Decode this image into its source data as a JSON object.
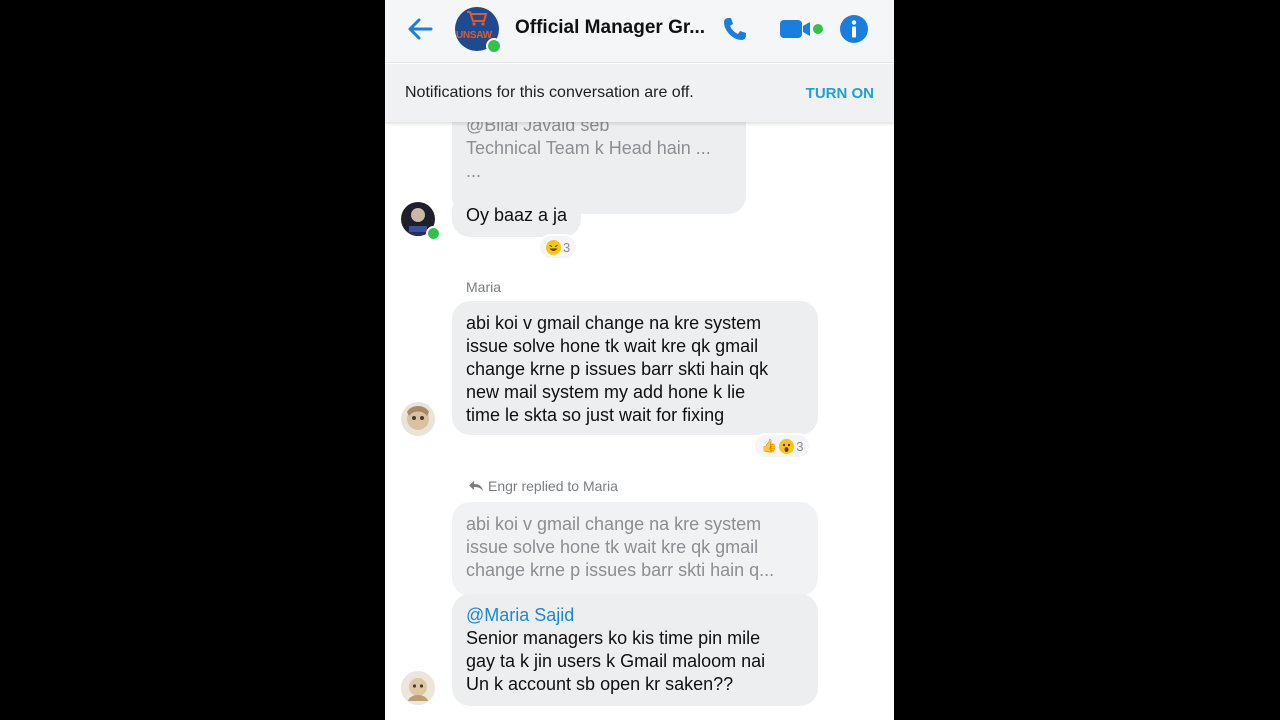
{
  "header": {
    "title": "Official Manager Gr...",
    "avatar_text": "UNSAW"
  },
  "notification": {
    "text": "Notifications for this conversation are off.",
    "action": "TURN ON"
  },
  "messages": [
    {
      "type": "quoted_partial",
      "lines": "@Bilal Javaid seb\nTechnical Team k Head hain ...\n..."
    },
    {
      "type": "text",
      "text": "Oy baaz a ja",
      "reaction_count": "3"
    },
    {
      "type": "text",
      "sender": "Maria",
      "text": "abi koi v gmail change na kre system\nissue solve hone tk wait kre qk gmail\nchange krne p issues barr skti hain qk\nnew mail system my add hone k lie\ntime le skta so just wait for fixing",
      "reaction_count": "3"
    },
    {
      "type": "reply",
      "reply_label": "Engr replied to Maria",
      "quoted": "abi koi v gmail change na kre system\nissue solve hone tk wait kre qk gmail\nchange krne p issues barr skti hain q...",
      "mention": "@Maria Sajid",
      "text": "Senior managers ko kis time pin mile\ngay ta k jin users k Gmail maloom nai\nUn k account sb open kr saken??"
    }
  ],
  "colors": {
    "accent": "#1a73e8",
    "online": "#31c24a",
    "bubble": "#eceef0",
    "turn_on": "#1ea0d8"
  }
}
